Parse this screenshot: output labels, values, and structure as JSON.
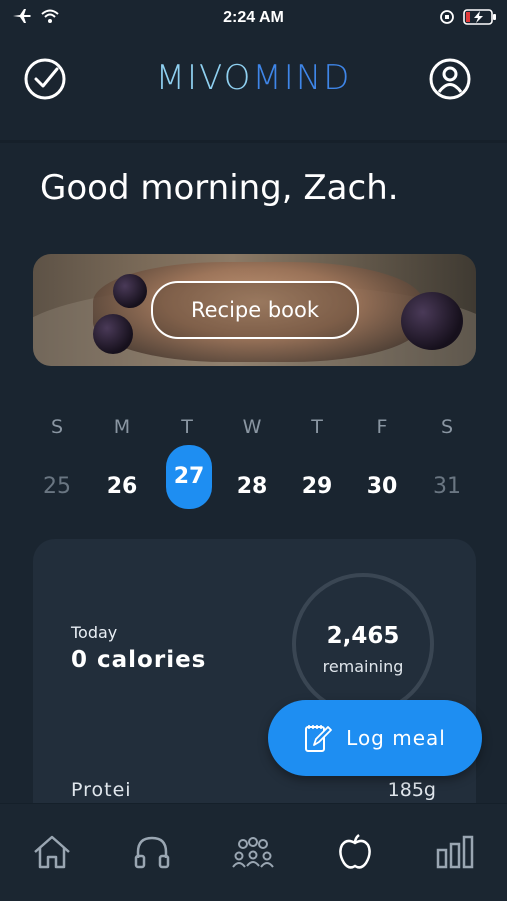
{
  "status_bar": {
    "time": "2:24 AM"
  },
  "header": {
    "logo_part1": "MIVO",
    "logo_part2": "MIND"
  },
  "greeting": "Good morning, Zach.",
  "banner": {
    "button_label": "Recipe book"
  },
  "week": {
    "days": [
      {
        "letter": "S",
        "num": "25",
        "state": "dim"
      },
      {
        "letter": "M",
        "num": "26",
        "state": "normal"
      },
      {
        "letter": "T",
        "num": "27",
        "state": "selected"
      },
      {
        "letter": "W",
        "num": "28",
        "state": "normal"
      },
      {
        "letter": "T",
        "num": "29",
        "state": "normal"
      },
      {
        "letter": "F",
        "num": "30",
        "state": "normal"
      },
      {
        "letter": "S",
        "num": "31",
        "state": "dim"
      }
    ]
  },
  "summary": {
    "today_label": "Today",
    "calories_label": "0 calories",
    "remaining_value": "2,465",
    "remaining_label": "remaining",
    "protein_label": "Protei",
    "protein_value": "185g"
  },
  "fab": {
    "label": "Log meal"
  },
  "nav": [
    "home-icon",
    "headphones-icon",
    "community-icon",
    "apple-icon",
    "stats-icon"
  ],
  "colors": {
    "background": "#1a2530",
    "accent": "#1e8ef2",
    "card": "#222e3b"
  }
}
